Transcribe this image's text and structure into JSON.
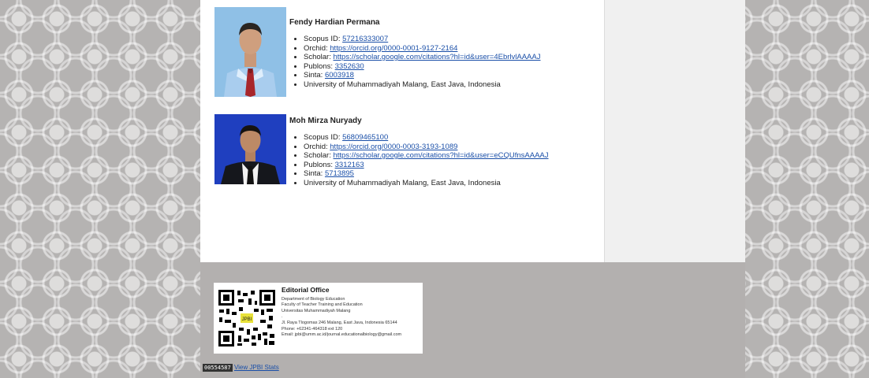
{
  "people": [
    {
      "name": "Fendy Hardian Permana",
      "details": [
        {
          "label": "Scopus ID: ",
          "link": "57216333007"
        },
        {
          "label": "Orchid: ",
          "link": "https://orcid.org/0000-0001-9127-2164"
        },
        {
          "label": "Scholar: ",
          "link": "https://scholar.google.com/citations?hl=id&user=4EbrlvlAAAAJ"
        },
        {
          "label": "Publons: ",
          "link": "3352630"
        },
        {
          "label": "Sinta: ",
          "link": "6003918"
        },
        {
          "label": "University of Muhammadiyah Malang, East Java, Indonesia",
          "link": ""
        }
      ]
    },
    {
      "name": "Moh Mirza Nuryady",
      "details": [
        {
          "label": "Scopus ID: ",
          "link": "56809465100"
        },
        {
          "label": "Orchid: ",
          "link": "https://orcid.org/0000-0003-3193-1089"
        },
        {
          "label": "Scholar: ",
          "link": "https://scholar.google.com/citations?hl=id&user=eCQUfnsAAAAJ"
        },
        {
          "label": "Publons: ",
          "link": "3312163"
        },
        {
          "label": "Sinta: ",
          "link": "5713895"
        },
        {
          "label": "University of Muhammadiyah Malang, East Java, Indonesia",
          "link": ""
        }
      ]
    }
  ],
  "office": {
    "title": "Editorial Office",
    "lines": [
      "Department of Biology Education",
      "Faculty of Teacher Training and Education",
      "Universitas Muhammadiyah Malang",
      ".",
      "Jl. Raya Tlogomas 246 Malang, East Java, Indonesia 65144",
      "Phone: +62341-464318 ext 120",
      "Email: jpbi@umm.ac.id/journal.educationalbiology@gmail.com"
    ],
    "qr_badge": "JPBI"
  },
  "stats": {
    "counter": "00554587",
    "link_label": "View JPBI Stats"
  },
  "colors": {
    "link": "#1a4fa8",
    "footer": "#b3b0af",
    "sidebar": "#f0f0f0"
  }
}
